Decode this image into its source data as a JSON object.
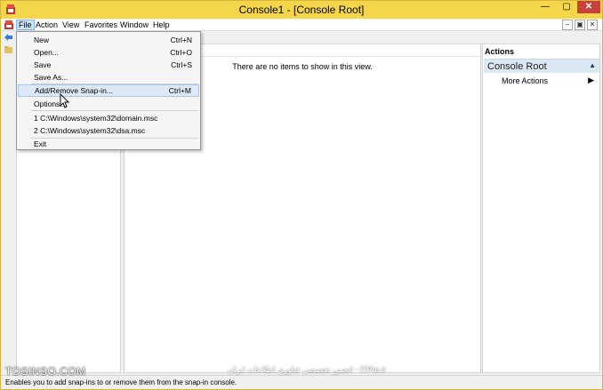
{
  "window": {
    "title": "Console1 - [Console Root]"
  },
  "menubar": {
    "items": [
      "File",
      "Action",
      "View",
      "Favorites",
      "Window",
      "Help"
    ],
    "active": "File"
  },
  "file_menu": {
    "items": [
      {
        "label": "New",
        "shortcut": "Ctrl+N"
      },
      {
        "label": "Open...",
        "shortcut": "Ctrl+O"
      },
      {
        "label": "Save",
        "shortcut": "Ctrl+S"
      },
      {
        "label": "Save As...",
        "shortcut": ""
      },
      {
        "label": "Add/Remove Snap-in...",
        "shortcut": "Ctrl+M"
      },
      {
        "label": "Options...",
        "shortcut": ""
      },
      {
        "label": "1 C:\\Windows\\system32\\domain.msc",
        "shortcut": ""
      },
      {
        "label": "2 C:\\Windows\\system32\\dsa.msc",
        "shortcut": ""
      },
      {
        "label": "Exit",
        "shortcut": ""
      }
    ],
    "hovered": "Add/Remove Snap-in..."
  },
  "center": {
    "empty_message": "There are no items to show in this view."
  },
  "actions": {
    "title": "Actions",
    "section": "Console Root",
    "item": "More Actions"
  },
  "statusbar": {
    "text": "Enables you to add snap-ins to or remove them from the snap-in console."
  },
  "watermark": {
    "left": "TOSINSO.COM",
    "center": "انجمن تخصصی فناوری اطلاعات ایران - ITPro.ir"
  },
  "colors": {
    "titlebar": "#f5d64a",
    "close": "#c7433a",
    "hover": "#dde9f7",
    "actions_section": "#dbe7f3"
  },
  "icons": {
    "app": "mmc-console-icon",
    "back": "back-arrow-icon",
    "folder": "folder-icon",
    "submenu": "triangle-right-icon",
    "collapse": "triangle-up-icon"
  }
}
